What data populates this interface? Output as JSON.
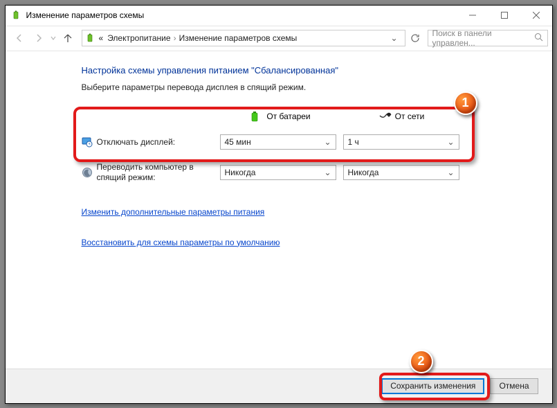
{
  "window": {
    "title": "Изменение параметров схемы"
  },
  "breadcrumb": {
    "root_indicator": "«",
    "item1": "Электропитание",
    "item2": "Изменение параметров схемы"
  },
  "search": {
    "placeholder": "Поиск в панели управлен..."
  },
  "main": {
    "heading": "Настройка схемы управления питанием \"Сбалансированная\"",
    "subhead": "Выберите параметры перевода дисплея в спящий режим.",
    "col_battery": "От батареи",
    "col_ac": "От сети",
    "row_display": "Отключать дисплей:",
    "row_sleep": "Переводить компьютер в спящий режим:",
    "display_battery": "45 мин",
    "display_ac": "1 ч",
    "sleep_battery": "Никогда",
    "sleep_ac": "Никогда",
    "link_advanced": "Изменить дополнительные параметры питания",
    "link_restore": "Восстановить для схемы параметры по умолчанию"
  },
  "footer": {
    "save": "Сохранить изменения",
    "cancel": "Отмена"
  },
  "badges": {
    "one": "1",
    "two": "2"
  }
}
